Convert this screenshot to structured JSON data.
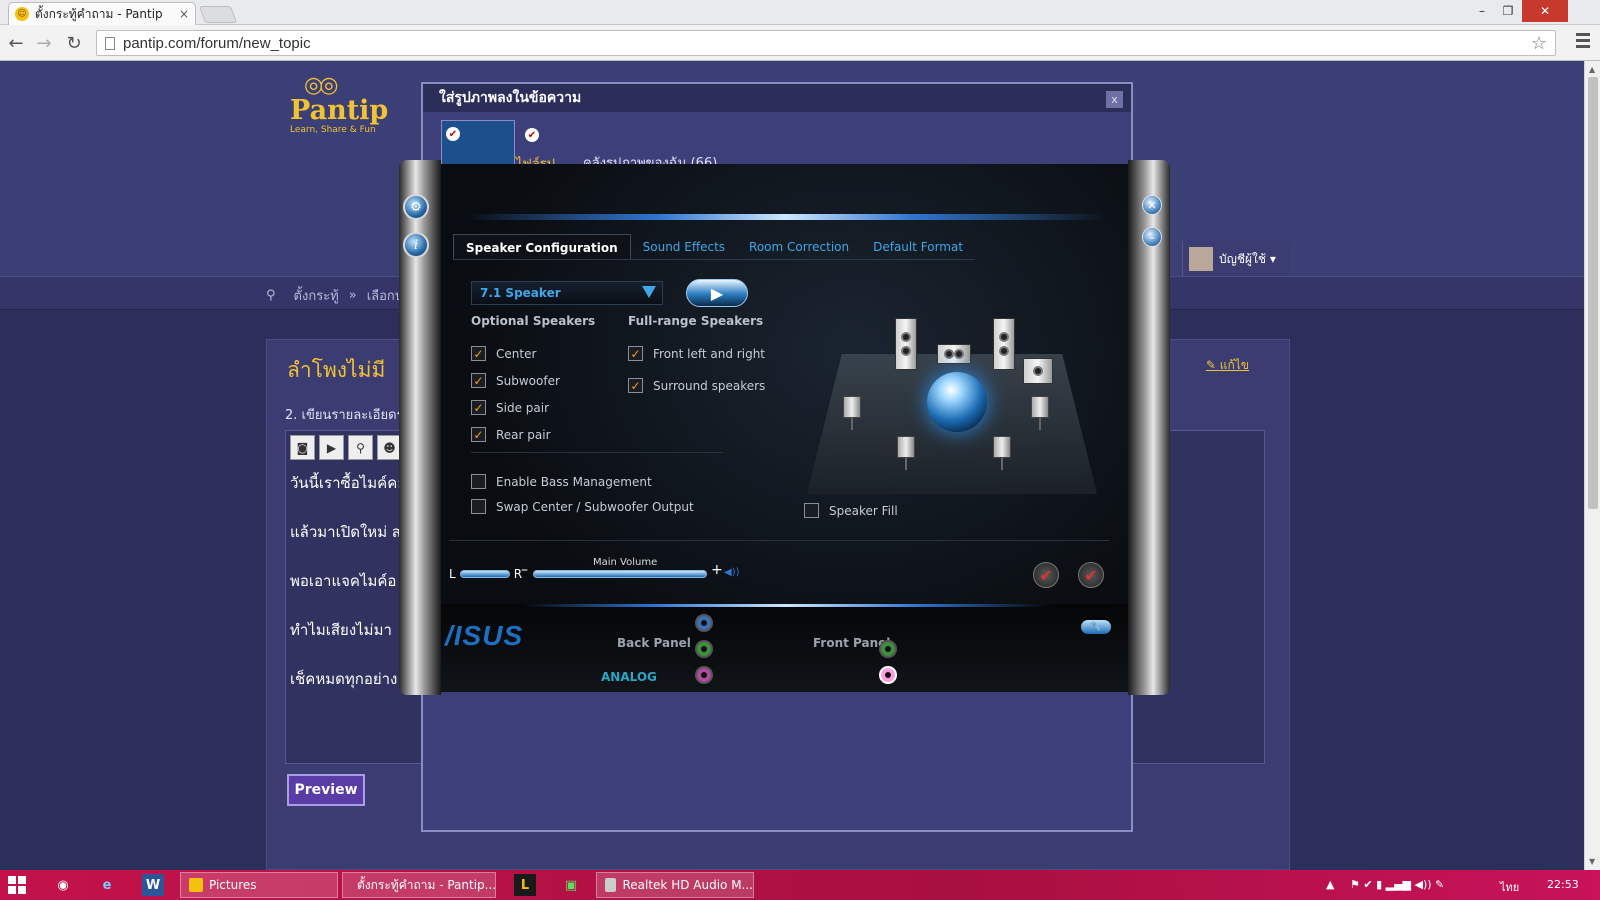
{
  "browser": {
    "tab_title": "ตั้งกระทู้คำถาม - Pantip",
    "tab_close": "×",
    "url": "pantip.com/forum/new_topic",
    "window_controls": [
      "–",
      "❐",
      "✕"
    ]
  },
  "pantip": {
    "logo_name": "Pantip",
    "logo_tagline": "Learn, Share & Fun",
    "user_name": "บัญชีผู้ใช้ ▾",
    "breadcrumb": [
      "ตั้งกระทู้",
      "»",
      "เลือกป"
    ],
    "topic_title": "ลำโพงไม่มี",
    "edit_link": "แก้ไข",
    "step_label": "2. เขียนรายละเอียดร",
    "editor_lines": [
      "วันนี้เราซื้อไมค์คอ",
      "แล้วมาเปิดใหม่ ส",
      "พอเอาแจคไมค์อ",
      "ทำไมเสียงไม่มา",
      "เช็คหมดทุกอย่าง"
    ],
    "preview_button": "Preview"
  },
  "dialog": {
    "title": "ใส่รูปภาพลงในข้อความ",
    "close": "x",
    "tab_upload": "ไฟล์รูป",
    "tab_library": "คลังรูปภาพของฉัน (66)"
  },
  "realtek": {
    "tabs": [
      "Speaker Configuration",
      "Sound Effects",
      "Room Correction",
      "Default Format"
    ],
    "speaker_select": "7.1 Speaker",
    "optional_header": "Optional Speakers",
    "fullrange_header": "Full-range Speakers",
    "optional": [
      {
        "label": "Center",
        "checked": true
      },
      {
        "label": "Subwoofer",
        "checked": true
      },
      {
        "label": "Side pair",
        "checked": true
      },
      {
        "label": "Rear pair",
        "checked": true
      }
    ],
    "fullrange": [
      {
        "label": "Front left and right",
        "checked": true
      },
      {
        "label": "Surround speakers",
        "checked": true
      }
    ],
    "enable_bass": "Enable Bass Management",
    "swap_center": "Swap Center / Subwoofer Output",
    "speaker_fill": "Speaker Fill",
    "balance_left": "L",
    "balance_right": "R",
    "main_volume_label": "Main Volume",
    "volume_minus": "–",
    "volume_plus": "+",
    "brand": "/ISUS",
    "back_panel": "Back Panel",
    "front_panel": "Front Panel",
    "analog": "ANALOG"
  },
  "taskbar": {
    "pictures": "Pictures",
    "chrome_task": "ตั้งกระทู้คำถาม - Pantip...",
    "realtek_task": "Realtek HD Audio M...",
    "language": "ไทย",
    "clock": "22:53"
  },
  "colors": {
    "pantip_bg": "#2c2f5c",
    "pantip_gold": "#f1c232",
    "realtek_blue": "#3fa6e8",
    "taskbar": "#c3124a"
  }
}
